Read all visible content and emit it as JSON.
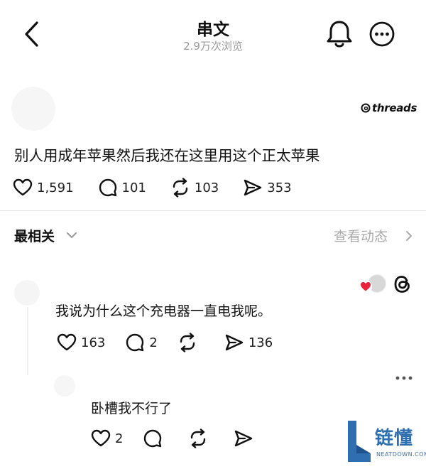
{
  "header": {
    "title": "串文",
    "views": "2.9万次浏览"
  },
  "post": {
    "brand": "threads",
    "text": "别人用成年苹果然后我还在这里用这个正太苹果",
    "likes": "1,591",
    "replies": "101",
    "reposts": "103",
    "shares": "353"
  },
  "sort": {
    "label": "最相关",
    "view_activity": "查看动态"
  },
  "comment": {
    "text": "我说为什么这个充电器一直电我呢。",
    "likes": "163",
    "replies": "2",
    "shares": "136"
  },
  "reply": {
    "text": "卧槽我不行了",
    "likes": "2"
  },
  "watermark": {
    "name": "链懂",
    "site": "NEATDOWN.COM"
  },
  "colors": {
    "text": "#111111",
    "muted": "#999999",
    "divider": "#e6e6e6",
    "heart_red": "#e8233b",
    "watermark_blue": "#2f6fb0"
  }
}
